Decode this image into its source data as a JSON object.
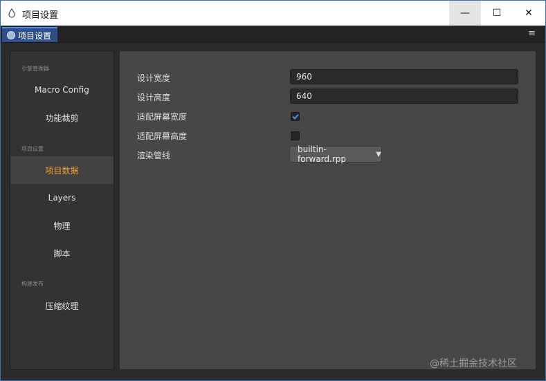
{
  "window": {
    "title": "项目设置",
    "minimize_glyph": "—",
    "maximize_glyph": "☐",
    "close_glyph": "✕"
  },
  "tab": {
    "label": "项目设置",
    "menu_glyph": "≡"
  },
  "sidebar": {
    "groups": [
      {
        "title": "引擎管理器",
        "items": [
          {
            "label": "Macro Config"
          },
          {
            "label": "功能裁剪"
          }
        ]
      },
      {
        "title": "项目设置",
        "items": [
          {
            "label": "项目数据",
            "active": true
          },
          {
            "label": "Layers"
          },
          {
            "label": "物理"
          },
          {
            "label": "脚本"
          }
        ]
      },
      {
        "title": "构建发布",
        "items": [
          {
            "label": "压缩纹理"
          }
        ]
      }
    ]
  },
  "settings": {
    "design_width": {
      "label": "设计宽度",
      "value": "960"
    },
    "design_height": {
      "label": "设计高度",
      "value": "640"
    },
    "fit_width": {
      "label": "适配屏幕宽度",
      "checked": true
    },
    "fit_height": {
      "label": "适配屏幕高度",
      "checked": false
    },
    "render_pipeline": {
      "label": "渲染管线",
      "value": "builtin-forward.rpp",
      "arrow": "▼"
    }
  },
  "watermark": "@稀土掘金技术社区",
  "colors": {
    "accent": "#f0a030",
    "tab_bg": "#2d4f86",
    "check": "#4c8cf0"
  }
}
